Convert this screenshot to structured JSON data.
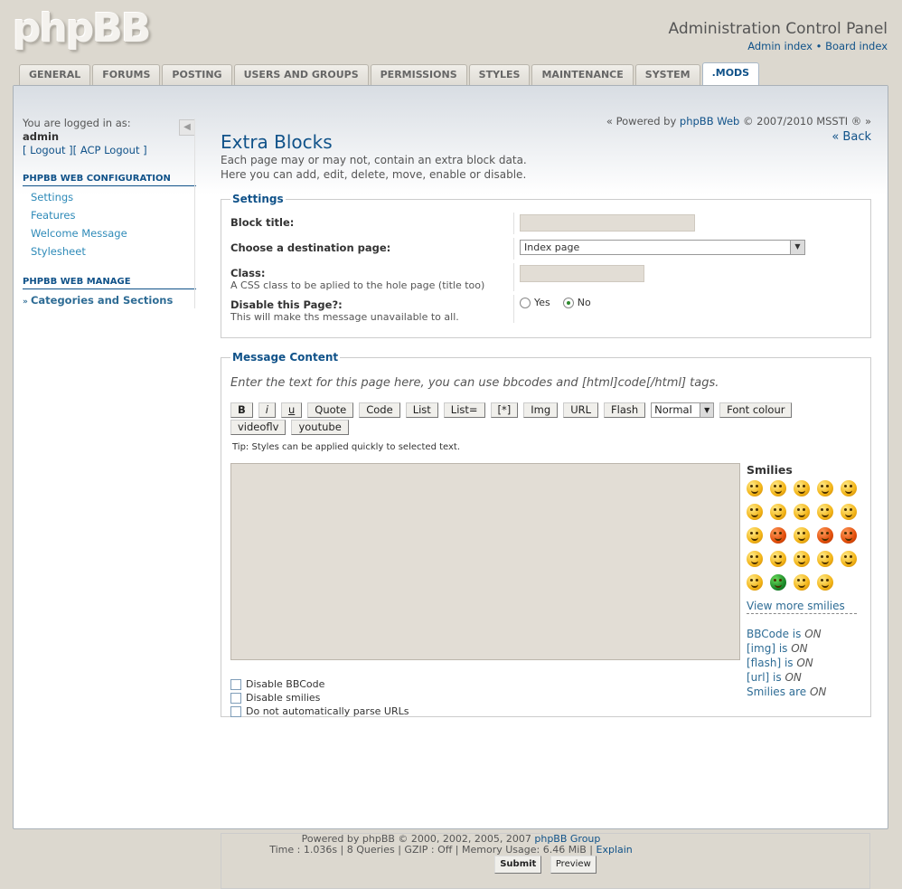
{
  "header": {
    "logo": "phpBB",
    "title": "Administration Control Panel",
    "link_admin": "Admin index",
    "sep": "•",
    "link_board": "Board index"
  },
  "tabs": [
    {
      "label": "GENERAL"
    },
    {
      "label": "FORUMS"
    },
    {
      "label": "POSTING"
    },
    {
      "label": "USERS AND GROUPS"
    },
    {
      "label": "PERMISSIONS"
    },
    {
      "label": "STYLES"
    },
    {
      "label": "MAINTENANCE"
    },
    {
      "label": "SYSTEM"
    },
    {
      "label": ".MODS",
      "active": true
    }
  ],
  "sidebar": {
    "logged_in_as": "You are logged in as:",
    "username": "admin",
    "logout": "[ Logout ]",
    "acp_logout": "[ ACP Logout ]",
    "collapse_icon": "◀",
    "config_head": "PHPBB WEB CONFIGURATION",
    "config_items": [
      "Settings",
      "Features",
      "Welcome Message",
      "Stylesheet"
    ],
    "manage_head": "PHPBB WEB MANAGE",
    "manage_items": [
      "Categories and Sections"
    ]
  },
  "main": {
    "powered": "« Powered by ",
    "powered_link": "phpBB Web",
    "powered_rest": " © 2007/2010 MSSTI ® »",
    "back": "« Back",
    "title": "Extra Blocks",
    "intro1": "Each page may or may not, contain an extra block data.",
    "intro2": "Here you can add, edit, delete, move, enable or disable."
  },
  "settings": {
    "legend": "Settings",
    "block_title_label": "Block title:",
    "block_title_value": "",
    "dest_label": "Choose a destination page:",
    "dest_value": "Index page",
    "class_label": "Class:",
    "class_explain": "A CSS class to be aplied to the hole page (title too)",
    "class_value": "",
    "disable_label": "Disable this Page?:",
    "disable_explain": "This will make ths message unavailable to all.",
    "yes": "Yes",
    "no": "No"
  },
  "message": {
    "legend": "Message Content",
    "hint": "Enter the text for this page here, you can use bbcodes and [html]code[/html] tags.",
    "buttons": [
      "B",
      "i",
      "u",
      "Quote",
      "Code",
      "List",
      "List=",
      "[*]",
      "Img",
      "URL",
      "Flash"
    ],
    "size_value": "Normal",
    "buttons2": [
      "Font colour",
      "videoflv",
      "youtube"
    ],
    "tip": "Tip: Styles can be applied quickly to selected text.",
    "text": "",
    "smilies_title": "Smilies",
    "view_more": "View more smilies",
    "bbcode": "BBCode is ",
    "bbcode_state": "ON",
    "img": "[img] is ",
    "img_state": "ON",
    "flash": "[flash] is ",
    "flash_state": "ON",
    "url": "[url] is ",
    "url_state": "ON",
    "smilies": "Smilies are ",
    "smilies_state": "ON",
    "opt1": "Disable BBCode",
    "opt2": "Disable smilies",
    "opt3": "Do not automatically parse URLs"
  },
  "actions": {
    "submit": "Submit",
    "preview": "Preview"
  },
  "footer": {
    "line1": "Powered by phpBB © 2000, 2002, 2005, 2007 ",
    "line1_link": "phpBB Group",
    "line2": "Time : 1.036s | 8 Queries | GZIP : Off | Memory Usage: 6.46 MiB | ",
    "line2_link": "Explain"
  }
}
